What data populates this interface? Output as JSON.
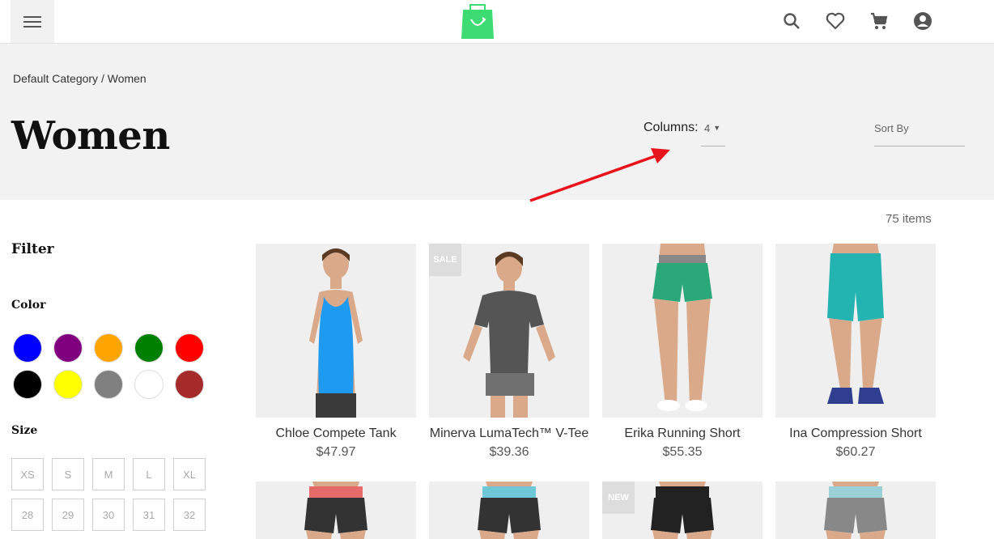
{
  "header": {
    "menu_icon": "hamburger-menu-icon",
    "logo_icon": "shopping-bag-logo",
    "icons": [
      "search-icon",
      "heart-icon",
      "cart-icon",
      "account-icon"
    ]
  },
  "breadcrumb": {
    "items": [
      "Default Category",
      "Women"
    ],
    "separator": "/"
  },
  "page_title": "Women",
  "toolbar": {
    "columns_label": "Columns:",
    "columns_value": "4",
    "sort_placeholder": "Sort By",
    "items_count": "75 items"
  },
  "filter": {
    "title": "Filter",
    "color_title": "Color",
    "colors": [
      "#0000ff",
      "#800080",
      "#ffa500",
      "#008000",
      "#ff0000",
      "#000000",
      "#ffff00",
      "#808080",
      "#ffffff",
      "#a52a2a"
    ],
    "size_title": "Size",
    "sizes": [
      "XS",
      "S",
      "M",
      "L",
      "XL",
      "28",
      "29",
      "30",
      "31",
      "32"
    ]
  },
  "products": [
    {
      "name": "Chloe Compete Tank",
      "price": "$47.97",
      "badge": ""
    },
    {
      "name": "Minerva LumaTech™ V-Tee",
      "price": "$39.36",
      "badge": "SALE"
    },
    {
      "name": "Erika Running Short",
      "price": "$55.35",
      "badge": ""
    },
    {
      "name": "Ina Compression Short",
      "price": "$60.27",
      "badge": ""
    },
    {
      "name": "",
      "price": "",
      "badge": ""
    },
    {
      "name": "",
      "price": "",
      "badge": ""
    },
    {
      "name": "",
      "price": "",
      "badge": "NEW"
    },
    {
      "name": "",
      "price": "",
      "badge": ""
    }
  ],
  "colors": {
    "accent_logo": "#3ddc73",
    "annotation_arrow": "#e8141b"
  }
}
